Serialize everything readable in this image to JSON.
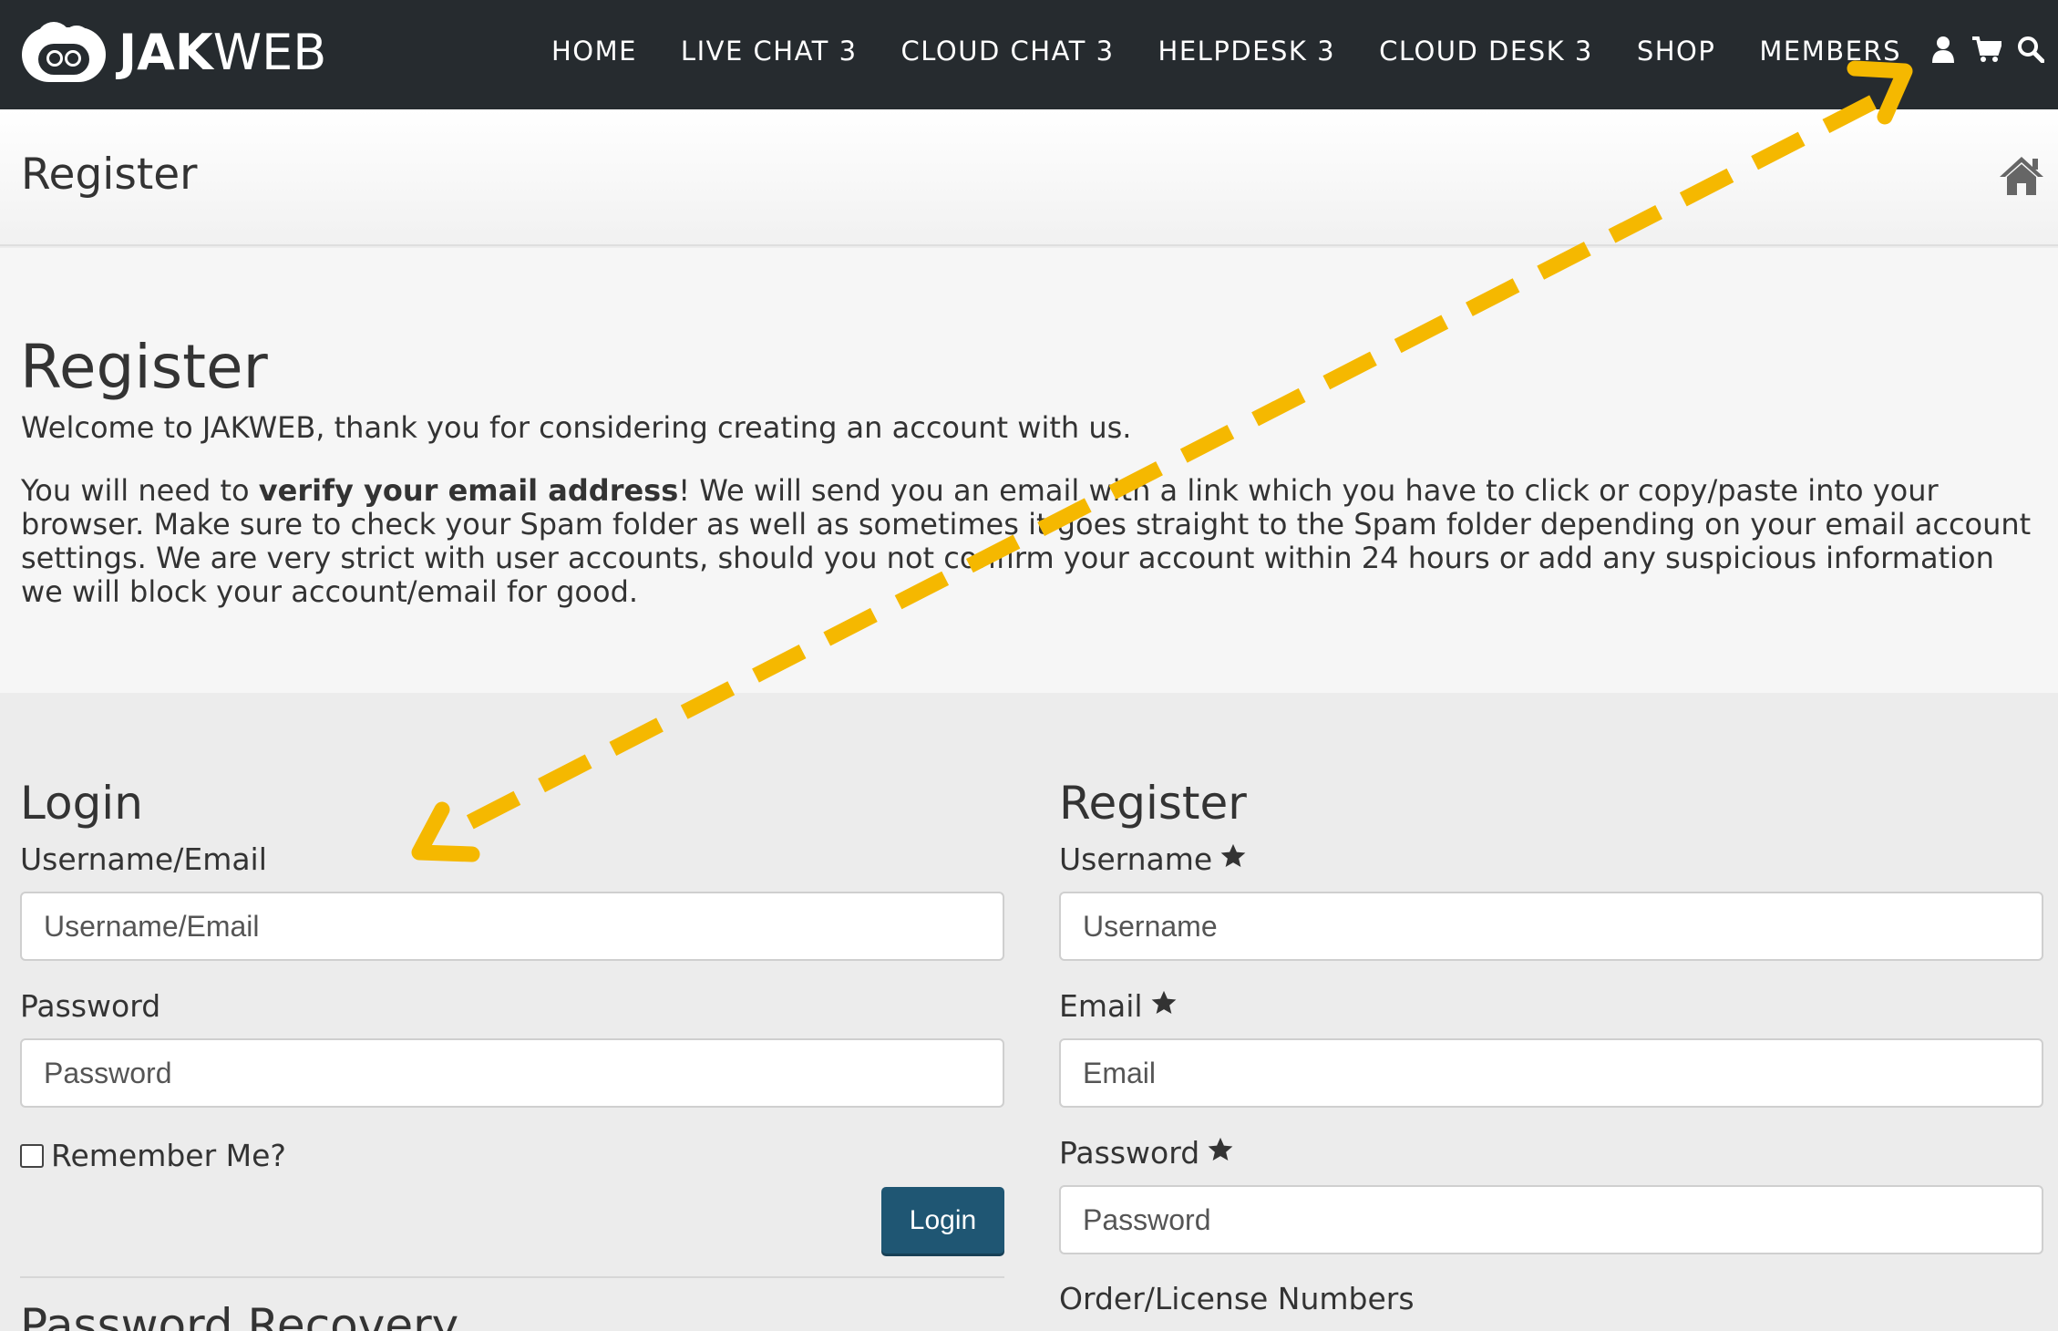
{
  "brand": {
    "logo_bold": "JAK",
    "logo_light": "WEB"
  },
  "nav": {
    "items": [
      "HOME",
      "LIVE CHAT 3",
      "CLOUD CHAT 3",
      "HELPDESK 3",
      "CLOUD DESK 3",
      "SHOP",
      "MEMBERS"
    ],
    "icons": [
      "user-icon",
      "cart-icon",
      "search-icon"
    ]
  },
  "header": {
    "title": "Register",
    "home_icon": "home-icon"
  },
  "intro": {
    "heading": "Register",
    "welcome": "Welcome to JAKWEB, thank you for considering creating an account with us.",
    "notice_pre": "You will need to ",
    "notice_bold": "verify your email address",
    "notice_post": "! We will send you an email with a link which you have to click or copy/paste into your browser. Make sure to check your Spam folder as well as sometimes it goes straight to the Spam folder depending on your email account settings. We are very strict with user accounts, should you not confirm your account within 24 hours or add any suspicious information we will block your account/email for good."
  },
  "login": {
    "heading": "Login",
    "username_label": "Username/Email",
    "username_placeholder": "Username/Email",
    "password_label": "Password",
    "password_placeholder": "Password",
    "remember_label": "Remember Me?",
    "button": "Login",
    "recovery_heading": "Password Recovery"
  },
  "register": {
    "heading": "Register",
    "username_label": "Username",
    "username_placeholder": "Username",
    "email_label": "Email",
    "email_placeholder": "Email",
    "password_label": "Password",
    "password_placeholder": "Password",
    "order_label": "Order/License Numbers",
    "required_icon": "star-icon"
  },
  "colors": {
    "nav_bg": "#262b2f",
    "button_bg": "#1f5673",
    "annotation_arrow": "#f5b800"
  }
}
